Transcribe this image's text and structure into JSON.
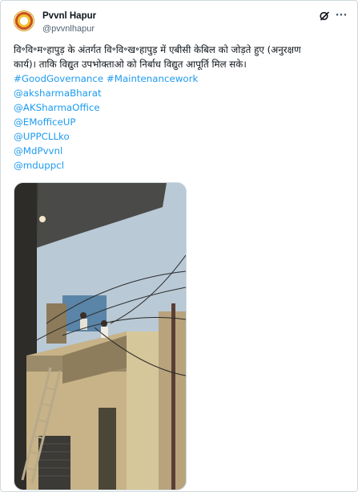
{
  "tweet": {
    "author_name": "Pvvnl Hapur",
    "author_handle": "@pvvnlhapur",
    "body_line1": "वि॰वि॰म॰हापुड़ के अंतर्गत वि॰वि॰ख॰हापुड़ में एबीसी केबिल को जोड़ते हुए (अनुरक्षण",
    "body_line2": "कार्य)। ताकि विद्युत उपभोक्ताओ को निर्बाध विद्युत आपूर्ति मिल सके।",
    "hashtags": [
      "#GoodGovernance",
      "#Maintenancework"
    ],
    "mentions": [
      "@aksharmaBharat",
      "@AKSharmaOffice",
      "@EMofficeUP",
      "@UPPCLLko",
      "@MdPvvnl",
      "@mduppcl"
    ]
  },
  "icons": {
    "grok": "grok-icon",
    "more": "more-icon",
    "avatar": "avatar-logo"
  },
  "colors": {
    "link": "#1d9bf0",
    "text": "#0f1419",
    "secondary": "#536471",
    "border": "#cfd9de"
  }
}
